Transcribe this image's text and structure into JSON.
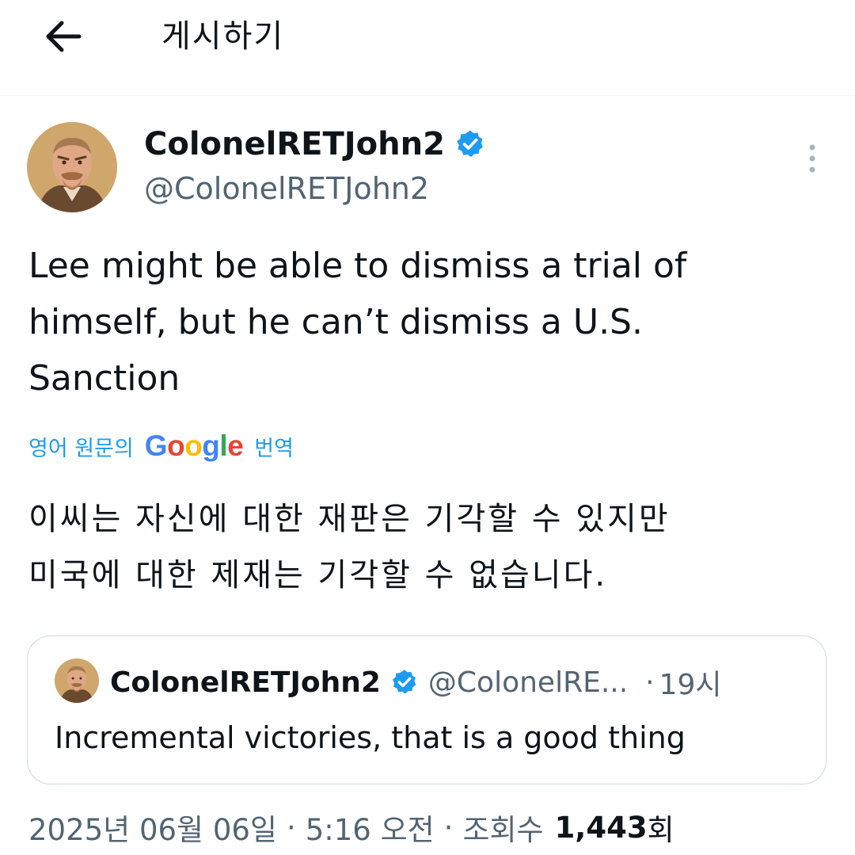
{
  "header": {
    "back_icon": "arrow-left-icon",
    "title": "게시하기"
  },
  "author": {
    "display_name": "ColonelRETJohn2",
    "handle": "@ColonelRETJohn2",
    "verified_icon": "verified-badge-icon",
    "more_icon": "more-vertical-icon"
  },
  "tweet": {
    "text": "Lee might be able to dismiss a trial of\nhimself, but he can’t dismiss a U.S.\nSanction",
    "translate": {
      "prefix": "영어 원문의",
      "google": "Google",
      "suffix": "번역",
      "text": "이씨는 자신에 대한 재판은 기각할 수 있지만\n미국에 대한 제재는 기각할 수 없습니다."
    }
  },
  "quote": {
    "display_name": "ColonelRETJohn2",
    "handle": "@ColonelRE...",
    "dot": "·",
    "time": "19시",
    "text": "Incremental victories, that is a good thing"
  },
  "meta": {
    "date": "2025년 06월 06일",
    "time": "5:16 오전",
    "views_label": "조회수",
    "views_count": "1,443",
    "views_unit": "회",
    "separator": "·"
  },
  "colors": {
    "accent": "#1d9bf0",
    "text": "#0f1419",
    "secondary": "#536471",
    "border": "#cfd9de",
    "google_blue": "#4285f4",
    "google_red": "#ea4335",
    "google_yellow": "#fbbc05",
    "google_green": "#34a853"
  }
}
